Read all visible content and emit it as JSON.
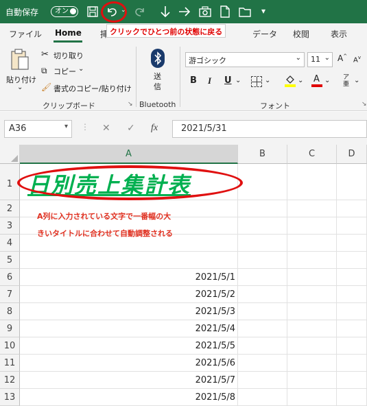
{
  "titlebar": {
    "autosave_label": "自動保存",
    "toggle_label": "オン",
    "icons": [
      "save-icon",
      "undo-icon",
      "redo-icon",
      "down-arrow-icon",
      "right-arrow-icon",
      "camera-icon",
      "document-icon",
      "folder-icon",
      "customize-icon"
    ]
  },
  "tooltip": "クリックでひとつ前の状態に戻る",
  "tabs": [
    "ファイル",
    "Home",
    "挿",
    "データ",
    "校閲",
    "表示"
  ],
  "ribbon": {
    "paste_label": "貼り付け",
    "cut_label": "切り取り",
    "copy_label": "コピー",
    "format_painter_label": "書式のコピー/貼り付け",
    "clipboard_group": "クリップボード",
    "bluetooth_send": "送\n信",
    "bluetooth_group": "Bluetooth",
    "font_name": "游ゴシック",
    "font_size": "11",
    "font_group": "フォント",
    "bold": "B",
    "italic": "I",
    "underline": "U"
  },
  "formula_bar": {
    "name_box": "A36",
    "formula": "2021/5/31"
  },
  "grid": {
    "columns": [
      "A",
      "B",
      "C",
      "D"
    ],
    "rows": [
      "1",
      "2",
      "3",
      "4",
      "5",
      "6",
      "7",
      "8",
      "9",
      "10",
      "11",
      "12",
      "13"
    ],
    "title": "日別売上集計表",
    "note_line1": "A列に入力されている文字で一番幅の大",
    "note_line2": "きいタイトルに合わせて自動調整される",
    "dates": [
      "2021/5/1",
      "2021/5/2",
      "2021/5/3",
      "2021/5/4",
      "2021/5/5",
      "2021/5/6",
      "2021/5/7",
      "2021/5/8"
    ]
  },
  "colors": {
    "excel_green": "#217346",
    "title_green": "#00b050",
    "annotation_red": "#e01010"
  }
}
